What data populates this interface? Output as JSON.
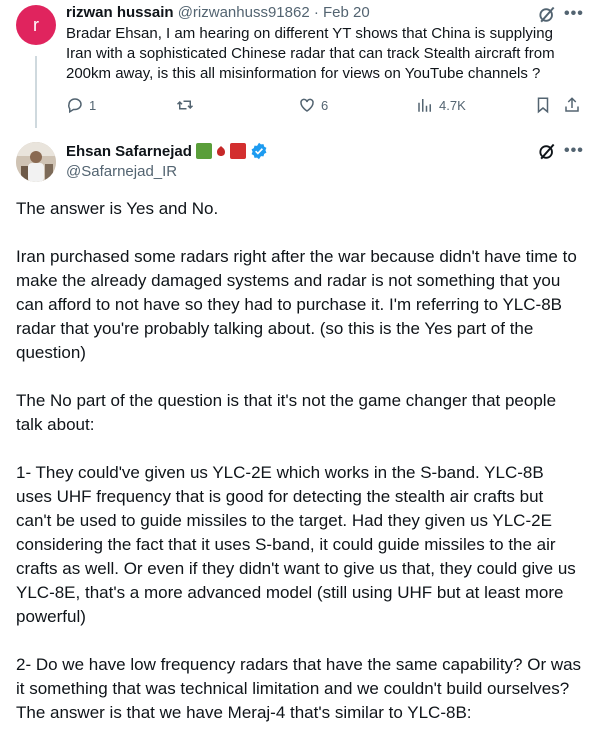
{
  "reply": {
    "avatar_letter": "r",
    "author_name": "rizwan hussain",
    "author_handle": "@rizwanhuss91862",
    "separator": "·",
    "date": "Feb 20",
    "text": "Bradar Ehsan, I am hearing on different YT shows that China is supplying Iran with a sophisticated Chinese radar that can track Stealth aircraft from 200km away, is this all misinformation for views on YouTube channels ?",
    "more_label": "•••",
    "actions": {
      "reply_count": "1",
      "retweet_count": "",
      "like_count": "6",
      "view_count": "4.7K"
    }
  },
  "main_post": {
    "author_name": "Ehsan Safarnejad",
    "author_handle": "@Safarnejad_IR",
    "more_label": "•••",
    "paragraphs": [
      "The answer is Yes and No.",
      "Iran purchased some radars right after the war because didn't have time to make the already damaged systems and radar is not something that you can afford to not have so they had to purchase it. I'm referring to YLC-8B radar that you're probably talking about. (so this is the Yes part of the question)",
      "The No part of the question is that it's not the game changer that people talk about:",
      "1- They could've given us YLC-2E which works in the S-band. YLC-8B uses UHF frequency that is good for detecting the stealth air crafts but can't be used to guide missiles to the target. Had they given us YLC-2E considering the fact that it uses S-band, it could guide missiles to the air crafts as well. Or even if they didn't want to give us that, they could give us YLC-8E, that's a more advanced model (still using UHF but at least more powerful)",
      "2- Do we have low frequency radars that have the same capability? Or was it something that was technical limitation and we couldn't build ourselves? The answer is that we have Meraj-4 that's similar to YLC-8B:"
    ]
  },
  "colors": {
    "avatar_r": "#e0245e",
    "verified": "#1d9bf0",
    "muted": "#536471",
    "text": "#0f1419"
  }
}
